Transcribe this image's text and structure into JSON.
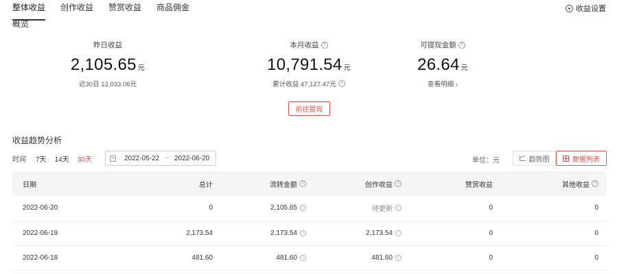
{
  "tabs": [
    {
      "label": "整体收益",
      "active": true
    },
    {
      "label": "创作收益",
      "active": false
    },
    {
      "label": "赞赏收益",
      "active": false
    },
    {
      "label": "商品佣金",
      "active": false
    }
  ],
  "settings_label": "收益设置",
  "overview": {
    "title": "概览",
    "yesterday": {
      "label": "昨日收益",
      "value": "2,105.65",
      "unit": "元",
      "sub": "近30日 12,033.06元"
    },
    "month": {
      "label": "本月收益",
      "value": "10,791.54",
      "unit": "元",
      "sub": "累计收益 47,127.47元"
    },
    "withdrawable": {
      "label": "可提现金额",
      "value": "26.64",
      "unit": "元",
      "sub": "查看明细 ›"
    },
    "withdraw_button": "前往提现"
  },
  "trend": {
    "title": "收益趋势分析",
    "time_label": "时间",
    "ranges": [
      "7天",
      "14天",
      "30天"
    ],
    "active_range": "30天",
    "date_start": "2022-05-22",
    "date_sep": "~",
    "date_end": "2022-06-20",
    "unit_label": "单位：元",
    "chart_view_label": "趋势图",
    "list_view_label": "数据列表"
  },
  "table": {
    "headers": [
      "日期",
      "总计",
      "流转金额",
      "创作收益",
      "赞赏收益",
      "其他收益"
    ],
    "rows": [
      [
        "2022-06-20",
        "0",
        "2,105.65",
        "待更新",
        "0",
        "0"
      ],
      [
        "2022-06-19",
        "2,173.54",
        "2,173.54",
        "2,173.54",
        "0",
        "0"
      ],
      [
        "2022-06-18",
        "481.60",
        "481.60",
        "481.60",
        "0",
        "0"
      ]
    ]
  },
  "colors": {
    "accent": "#d9534f",
    "header_bg": "#f5f5f5"
  }
}
